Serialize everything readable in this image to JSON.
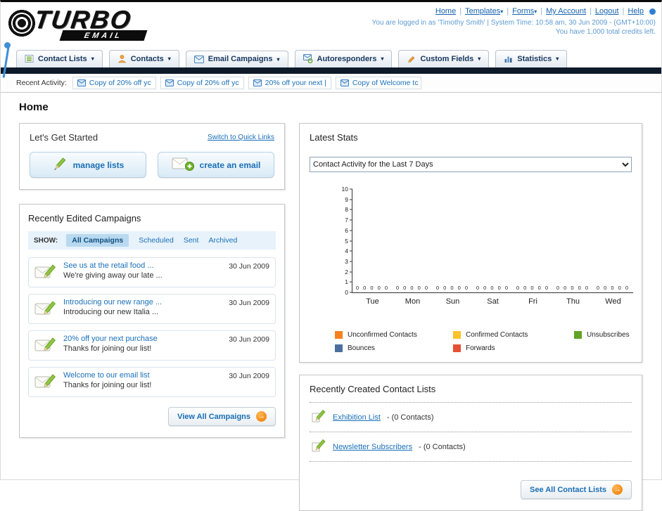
{
  "header": {
    "nav_links": [
      {
        "label": "Home",
        "caret": false
      },
      {
        "label": "Templates",
        "caret": true
      },
      {
        "label": "Forms",
        "caret": true
      },
      {
        "label": "My Account",
        "caret": false
      },
      {
        "label": "Logout",
        "caret": false
      },
      {
        "label": "Help",
        "caret": false
      }
    ],
    "login_info": "You are logged in as 'Timothy Smith' | System Time: 10:58 am, 30 Jun 2009 - (GMT+10:00)",
    "credits_info": "You have 1,000 total credits left.",
    "logo_primary": "TURBO",
    "logo_secondary": "EMAIL"
  },
  "main_nav": [
    {
      "label": "Contact Lists",
      "icon": "list-icon"
    },
    {
      "label": "Contacts",
      "icon": "contacts-icon"
    },
    {
      "label": "Email Campaigns",
      "icon": "envelope-icon"
    },
    {
      "label": "Autoresponders",
      "icon": "autoresponder-icon"
    },
    {
      "label": "Custom Fields",
      "icon": "fields-icon"
    },
    {
      "label": "Statistics",
      "icon": "stats-icon"
    }
  ],
  "recent_activity": {
    "label": "Recent Activity:",
    "items": [
      "Copy of 20% off yc",
      "Copy of 20% off yc",
      "20% off your next |",
      "Copy of Welcome tc"
    ]
  },
  "page_title": "Home",
  "get_started": {
    "title": "Let's Get Started",
    "switch_link": "Switch to Quick Links",
    "manage_label": "manage lists",
    "create_label": "create an email"
  },
  "campaigns": {
    "title": "Recently Edited Campaigns",
    "show_label": "SHOW:",
    "filters": [
      "All Campaigns",
      "Scheduled",
      "Sent",
      "Archived"
    ],
    "active_filter": "All Campaigns",
    "items": [
      {
        "title": "See us at the retail food ...",
        "subtitle": "We're giving away our late ...",
        "date": "30 Jun 2009"
      },
      {
        "title": "Introducing our new range ...",
        "subtitle": "Introducing our new Italia ...",
        "date": "30 Jun 2009"
      },
      {
        "title": "20% off your next purchase",
        "subtitle": "Thanks for joining our list!",
        "date": "30 Jun 2009"
      },
      {
        "title": "Welcome to our email list",
        "subtitle": "Thanks for joining our list!",
        "date": "30 Jun 2009"
      }
    ],
    "view_all_label": "View All Campaigns"
  },
  "stats": {
    "title": "Latest Stats",
    "dropdown_value": "Contact Activity for the Last 7 Days",
    "chart_data": {
      "type": "bar",
      "categories": [
        "Tue",
        "Mon",
        "Sun",
        "Sat",
        "Fri",
        "Thu",
        "Wed"
      ],
      "series": [
        {
          "name": "Unconfirmed Contacts",
          "color": "#f5821f",
          "values": [
            0,
            0,
            0,
            0,
            0,
            0,
            0
          ]
        },
        {
          "name": "Confirmed Contacts",
          "color": "#fdc32a",
          "values": [
            0,
            0,
            0,
            0,
            0,
            0,
            0
          ]
        },
        {
          "name": "Unsubscribes",
          "color": "#61a425",
          "values": [
            0,
            0,
            0,
            0,
            0,
            0,
            0
          ]
        },
        {
          "name": "Bounces",
          "color": "#4c6e9e",
          "values": [
            0,
            0,
            0,
            0,
            0,
            0,
            0
          ]
        },
        {
          "name": "Forwards",
          "color": "#e75133",
          "values": [
            0,
            0,
            0,
            0,
            0,
            0,
            0
          ]
        }
      ],
      "ylim": [
        0,
        10
      ],
      "yticks": [
        0,
        1,
        2,
        3,
        4,
        5,
        6,
        7,
        8,
        9,
        10
      ],
      "grid": false,
      "legend_position": "bottom",
      "title": "Contact Activity for the Last 7 Days",
      "xlabel": "",
      "ylabel": ""
    }
  },
  "contact_lists": {
    "title": "Recently Created Contact Lists",
    "items": [
      {
        "name": "Exhibition List",
        "detail": "- (0 Contacts)"
      },
      {
        "name": "Newsletter Subscribers",
        "detail": "- (0 Contacts)"
      }
    ],
    "see_all_label": "See All Contact Lists"
  }
}
